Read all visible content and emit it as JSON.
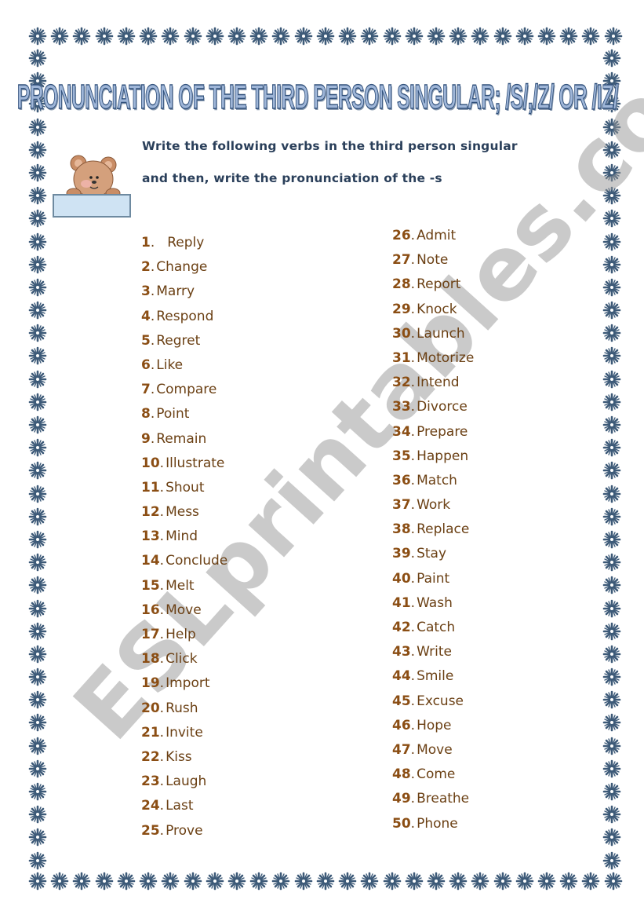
{
  "title": "PRONUNCIATION OF THE THIRD PERSON SINGULAR; /S/,/Z/ OR /IZ/",
  "instructions": {
    "line1": "Write the following verbs in the third person singular",
    "line2": "and then, write the pronunciation of the -s"
  },
  "decoration": {
    "border_icon": "snowflake-asterisk-icon",
    "border_color": "#3d5a78",
    "illustration": "teddy-bear-holding-sign"
  },
  "colors": {
    "title_fill": "#9fb6d8",
    "title_outline": "#2f4f7a",
    "instructions": "#2a3f5a",
    "list_number": "#8b4e14",
    "list_word": "#6b4014"
  },
  "verbs_left": [
    {
      "num": "1",
      "word": "Reply"
    },
    {
      "num": "2",
      "word": "Change"
    },
    {
      "num": "3",
      "word": "Marry"
    },
    {
      "num": "4",
      "word": "Respond"
    },
    {
      "num": "5",
      "word": "Regret"
    },
    {
      "num": "6",
      "word": "Like"
    },
    {
      "num": "7",
      "word": "Compare"
    },
    {
      "num": "8",
      "word": "Point"
    },
    {
      "num": "9",
      "word": "Remain"
    },
    {
      "num": "10",
      "word": "Illustrate"
    },
    {
      "num": "11",
      "word": "Shout"
    },
    {
      "num": "12",
      "word": "Mess"
    },
    {
      "num": "13",
      "word": "Mind"
    },
    {
      "num": "14",
      "word": "Conclude"
    },
    {
      "num": "15",
      "word": "Melt"
    },
    {
      "num": "16",
      "word": "Move"
    },
    {
      "num": "17",
      "word": "Help"
    },
    {
      "num": "18",
      "word": "Click"
    },
    {
      "num": "19",
      "word": "Import"
    },
    {
      "num": "20",
      "word": "Rush"
    },
    {
      "num": "21",
      "word": "Invite"
    },
    {
      "num": "22",
      "word": "Kiss"
    },
    {
      "num": "23",
      "word": "Laugh"
    },
    {
      "num": "24",
      "word": "Last"
    },
    {
      "num": "25",
      "word": "Prove"
    }
  ],
  "verbs_right": [
    {
      "num": "26",
      "word": "Admit"
    },
    {
      "num": "27",
      "word": "Note"
    },
    {
      "num": "28",
      "word": "Report"
    },
    {
      "num": "29",
      "word": "Knock"
    },
    {
      "num": "30",
      "word": "Launch"
    },
    {
      "num": "31",
      "word": "Motorize"
    },
    {
      "num": "32",
      "word": "Intend"
    },
    {
      "num": "33",
      "word": "Divorce"
    },
    {
      "num": "34",
      "word": "Prepare"
    },
    {
      "num": "35",
      "word": "Happen"
    },
    {
      "num": "36",
      "word": "Match"
    },
    {
      "num": "37",
      "word": "Work"
    },
    {
      "num": "38",
      "word": "Replace"
    },
    {
      "num": "39",
      "word": "Stay"
    },
    {
      "num": "40",
      "word": "Paint"
    },
    {
      "num": "41",
      "word": "Wash"
    },
    {
      "num": "42",
      "word": "Catch"
    },
    {
      "num": "43",
      "word": "Write"
    },
    {
      "num": "44",
      "word": "Smile"
    },
    {
      "num": "45",
      "word": "Excuse"
    },
    {
      "num": "46",
      "word": "Hope"
    },
    {
      "num": "47",
      "word": "Move"
    },
    {
      "num": "48",
      "word": "Come"
    },
    {
      "num": "49",
      "word": "Breathe"
    },
    {
      "num": "50",
      "word": "Phone"
    }
  ],
  "watermark": "ESLprintables.com"
}
